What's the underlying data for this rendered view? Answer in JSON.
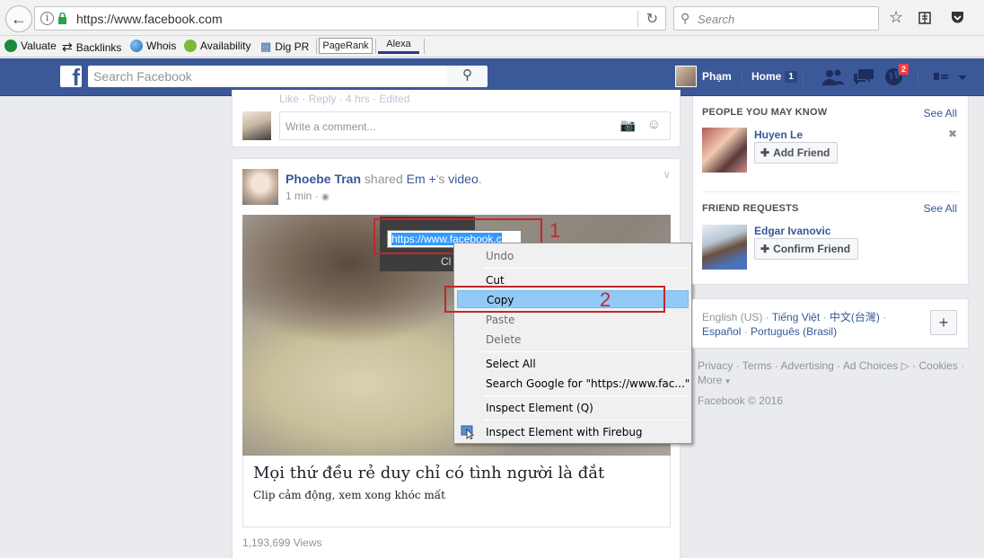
{
  "browser": {
    "url": "https://www.facebook.com",
    "search_placeholder": "Search",
    "bookmarks": [
      "Valuate",
      "Backlinks",
      "Whois",
      "Availability",
      "Dig PR",
      "PageRank",
      "Alexa"
    ]
  },
  "fb_header": {
    "search_placeholder": "Search Facebook",
    "user_name": "Phạm",
    "home_label": "Home",
    "home_count": "1",
    "notif_count": "2"
  },
  "comment_strip": {
    "actions": "Like · Reply · 4 hrs · Edited",
    "placeholder": "Write a comment..."
  },
  "post": {
    "author": "Phoebe Tran",
    "shared": "shared",
    "source": "Em +",
    "suffix": "'s",
    "object": "video",
    "time": "1 min ·",
    "video_url_text": "https://www.facebook.c",
    "video_cl": "Cl",
    "title": "Mọi thứ đều rẻ duy chỉ có tình người là đắt",
    "description": "Clip cảm động, xem xong khóc mất",
    "views": "1,193,699 Views"
  },
  "annotations": {
    "one": "1",
    "two": "2"
  },
  "context_menu": [
    {
      "label": "Undo",
      "disabled": true
    },
    {
      "label": "Cut",
      "disabled": false
    },
    {
      "label": "Copy",
      "disabled": false,
      "highlighted": true
    },
    {
      "label": "Paste",
      "disabled": true
    },
    {
      "label": "Delete",
      "disabled": true
    },
    {
      "label": "Select All",
      "disabled": false
    },
    {
      "label": "Search Google for \"https://www.fac...\"",
      "disabled": false
    },
    {
      "label": "Inspect Element (Q)",
      "disabled": false
    },
    {
      "label": "Inspect Element with Firebug",
      "disabled": false
    }
  ],
  "sidebar": {
    "people_header": "PEOPLE YOU MAY KNOW",
    "see_all": "See All",
    "person_name": "Huyen Le",
    "add_friend": "Add Friend",
    "requests_header": "FRIEND REQUESTS",
    "requester_name": "Edgar Ivanovic",
    "confirm_friend": "Confirm Friend"
  },
  "languages": {
    "current": "English (US)",
    "options": [
      "Tiếng Việt",
      "中文(台灣)",
      "Español",
      "Português (Brasil)"
    ]
  },
  "footer": {
    "links": [
      "Privacy",
      "Terms",
      "Advertising",
      "Ad Choices",
      "Cookies",
      "More"
    ],
    "copyright": "Facebook © 2016"
  }
}
